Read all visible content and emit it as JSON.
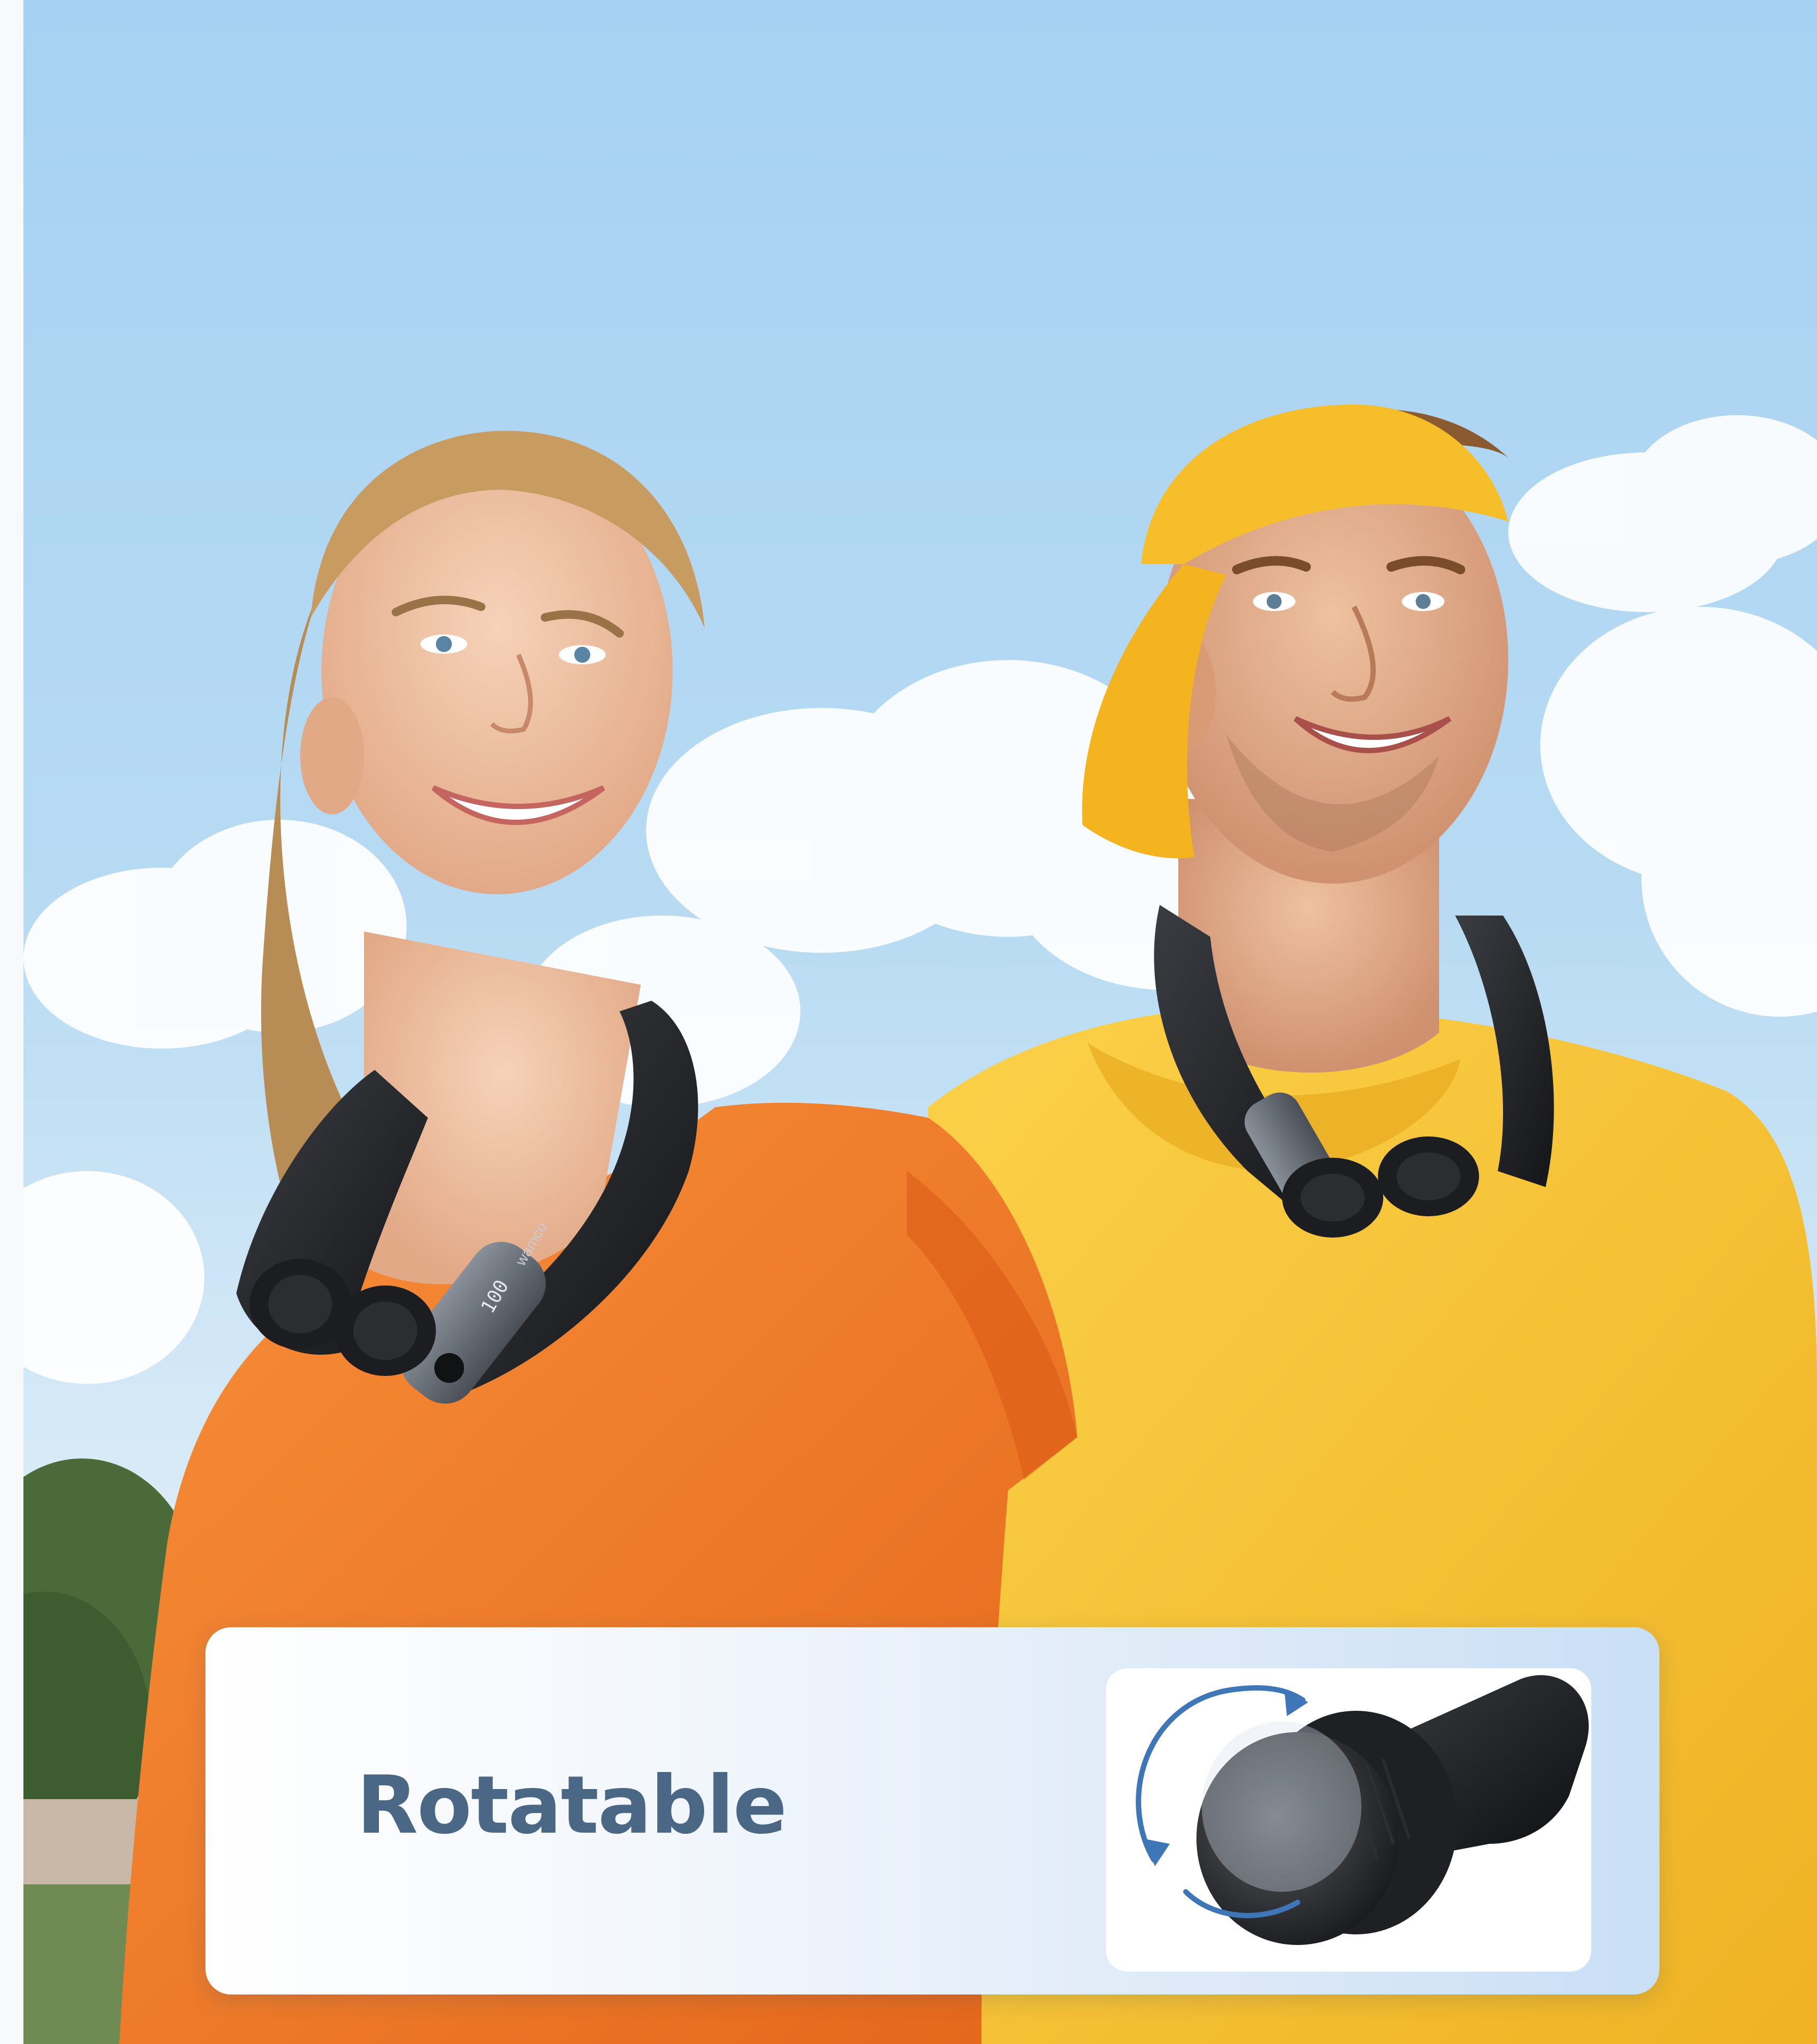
{
  "feature": {
    "label": "Rotatable"
  },
  "device": {
    "brand_text": "wamco",
    "battery_readout": "100"
  },
  "colors": {
    "sky_top": "#a9d3f3",
    "orange_shirt": "#f27a1f",
    "yellow_shirt": "#f8c231",
    "device_black": "#1b1d20",
    "label_blue": "#4b6786",
    "rotation_arrow": "#3e76b8"
  },
  "icons": {
    "rotation": "rotate-arrows-icon"
  }
}
